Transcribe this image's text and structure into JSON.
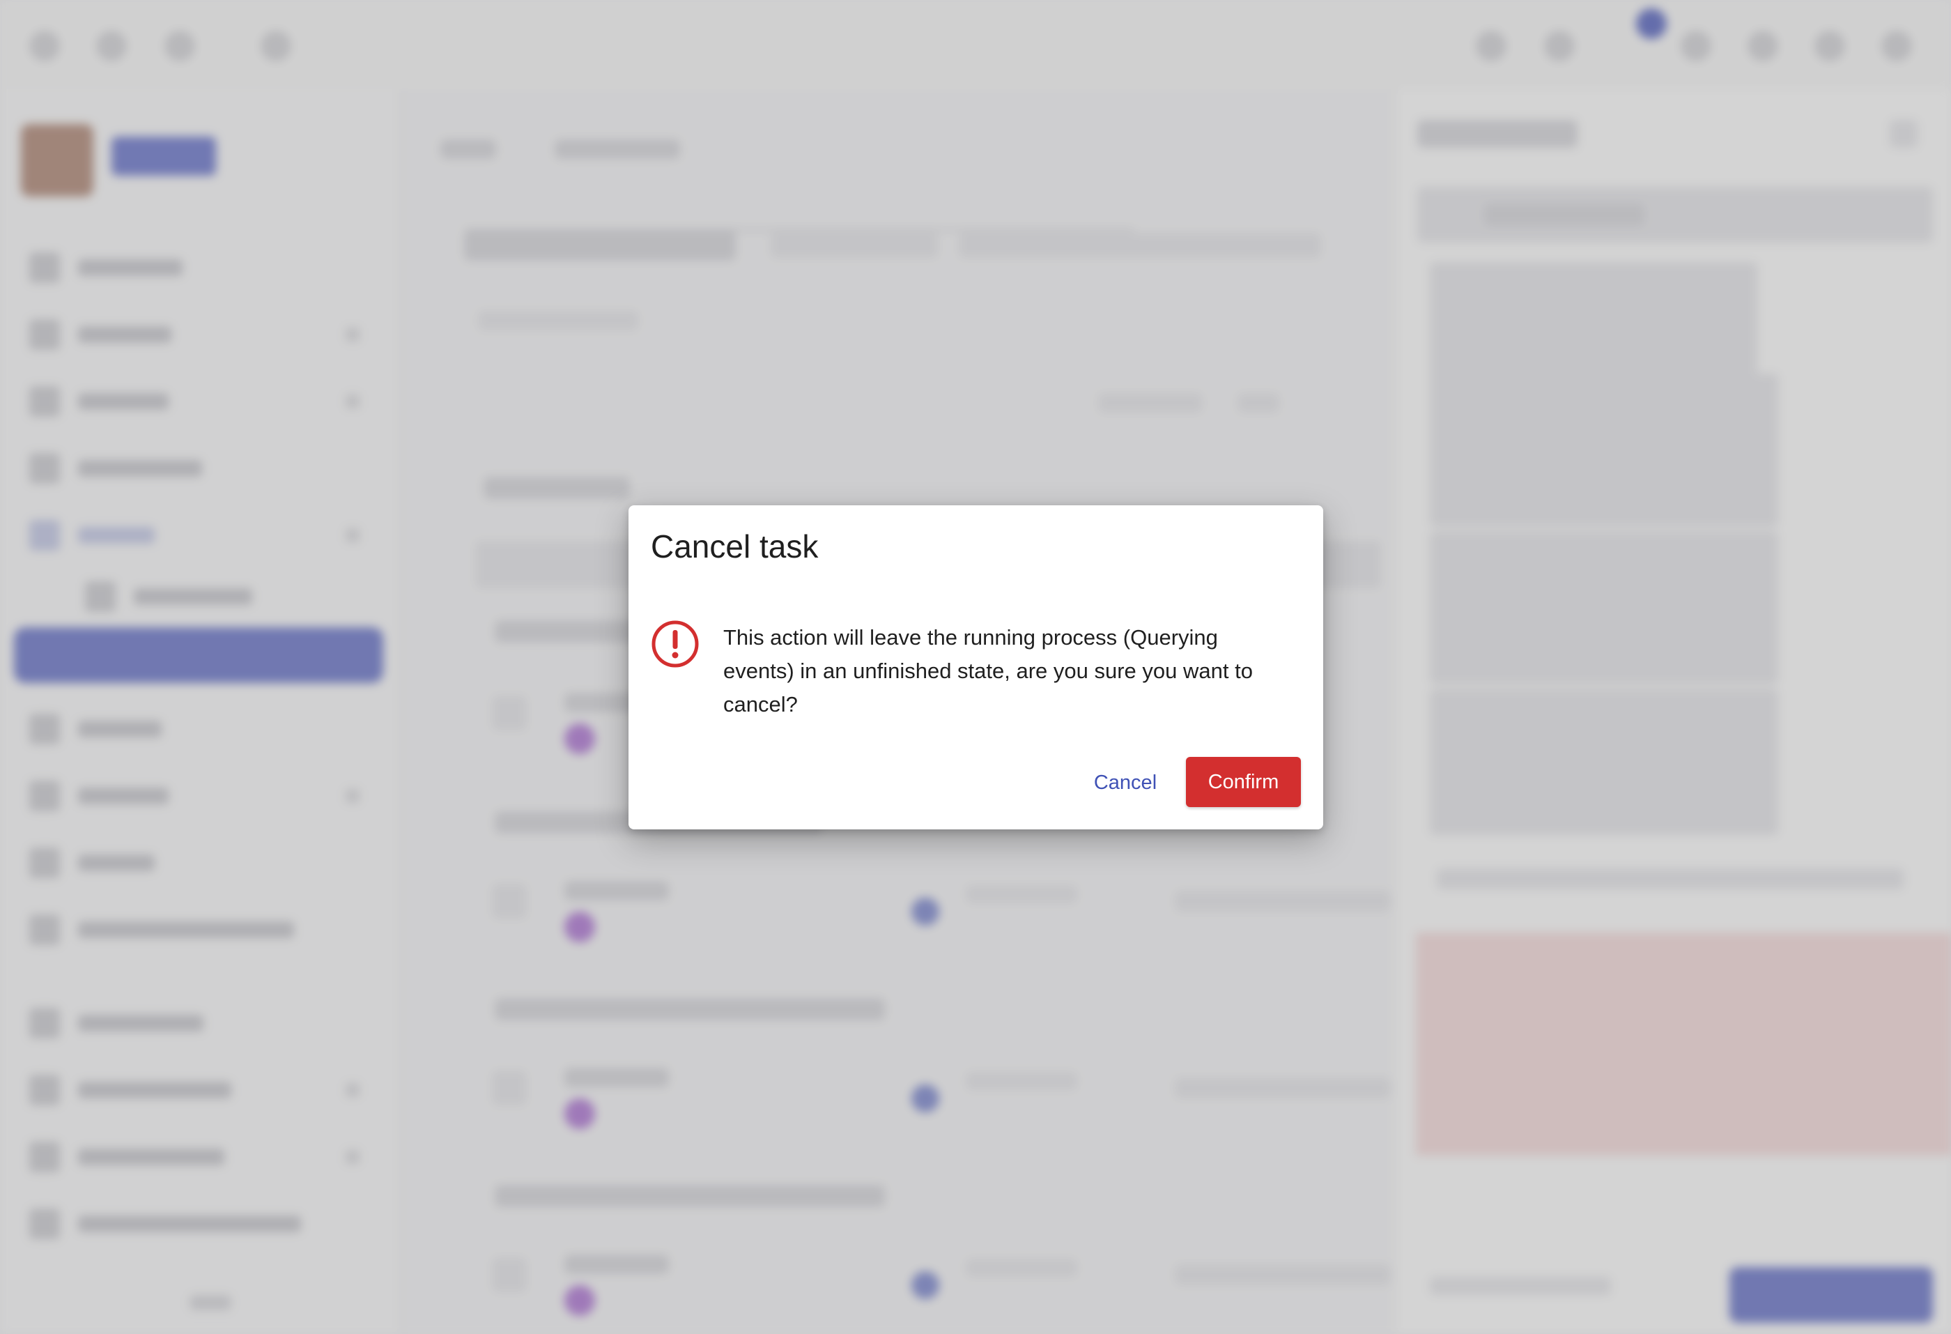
{
  "dialog": {
    "title": "Cancel task",
    "message": "This action will leave the running process (Querying events) in an unfinished state, are you sure you want to cancel?",
    "icon": "error-outline-icon",
    "cancel_label": "Cancel",
    "confirm_label": "Confirm"
  },
  "colors": {
    "accent": "#3f51b5",
    "danger": "#d32f2f",
    "scrim": "rgba(120,120,120,0.32)"
  }
}
